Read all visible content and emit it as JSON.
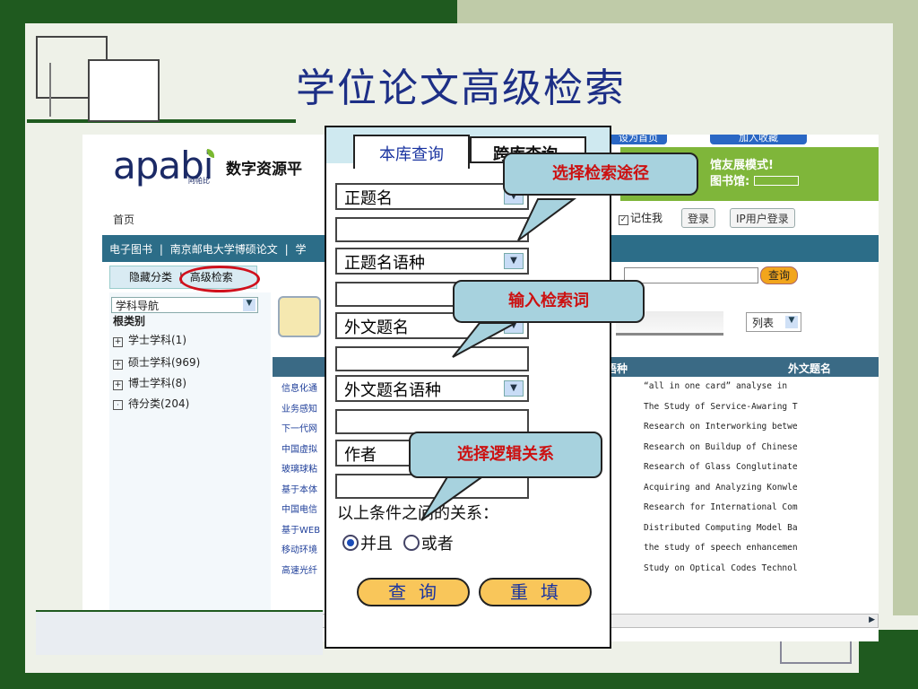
{
  "slide": {
    "title": "学位论文高级检索"
  },
  "site": {
    "logo_text": "apabi",
    "logo_sub": "阿帕比",
    "platform_name": "数字资源平",
    "set_home": "设为首页",
    "add_favorite": "加入收藏",
    "banner_line1": "馆友展模式!",
    "banner_line2": "图书馆: ",
    "home": "首页",
    "remember_me": "记住我",
    "login": "登录",
    "ip_login": "IP用户登录",
    "nav_items": [
      "电子图书",
      "南京邮电大学博硕论文",
      "学"
    ],
    "hide_category": "隐藏分类",
    "advanced_search": "高级检索",
    "query_button": "查询",
    "list_view": "列表"
  },
  "sidebar": {
    "nav_select": "学科导航",
    "root_category": "根类别",
    "categories": [
      {
        "label": "学士学科(1)"
      },
      {
        "label": "硕士学科(969)"
      },
      {
        "label": "博士学科(8)"
      },
      {
        "label": "待分类(204)"
      }
    ]
  },
  "table": {
    "col_lang_fragment": "语种",
    "col_foreign_title": "外文题名",
    "left_fragments": [
      "信息化通",
      "业务感知",
      "下一代网",
      "中国虚拟",
      "玻璃球粘",
      "基于本体",
      "中国电信",
      "基于WEB",
      "移动环境",
      "高速光纤"
    ],
    "foreign_titles": [
      "“all in one card” analyse in",
      "The Study of Service-Awaring T",
      "Research on Interworking betwe",
      "Research on Buildup of Chinese",
      "Research of Glass Conglutinate",
      "Acquiring and Analyzing Konwle",
      "Research for International Com",
      "Distributed Computing Model Ba",
      "the study of speech enhancemen",
      "Study on Optical Codes Technol"
    ]
  },
  "panel": {
    "tab_local": "本库查询",
    "tab_cross": "跨库查询",
    "field1": "正题名",
    "field2": "正题名语种",
    "field3": "外文题名",
    "field4": "外文题名语种",
    "field5": "作者",
    "relation_label": "以上条件之间的关系：",
    "and_label": "并且",
    "or_label": "或者",
    "search_button": "查询",
    "reset_button": "重填"
  },
  "callouts": {
    "select_path": "选择检索途径",
    "enter_terms": "输入检索词",
    "select_logic": "选择逻辑关系"
  },
  "colors": {
    "dark_green": "#1f5a1f",
    "title_blue": "#1d2f86",
    "callout_fill": "#a7d2de",
    "callout_text": "#cc1111",
    "button_orange": "#f9c65a"
  }
}
